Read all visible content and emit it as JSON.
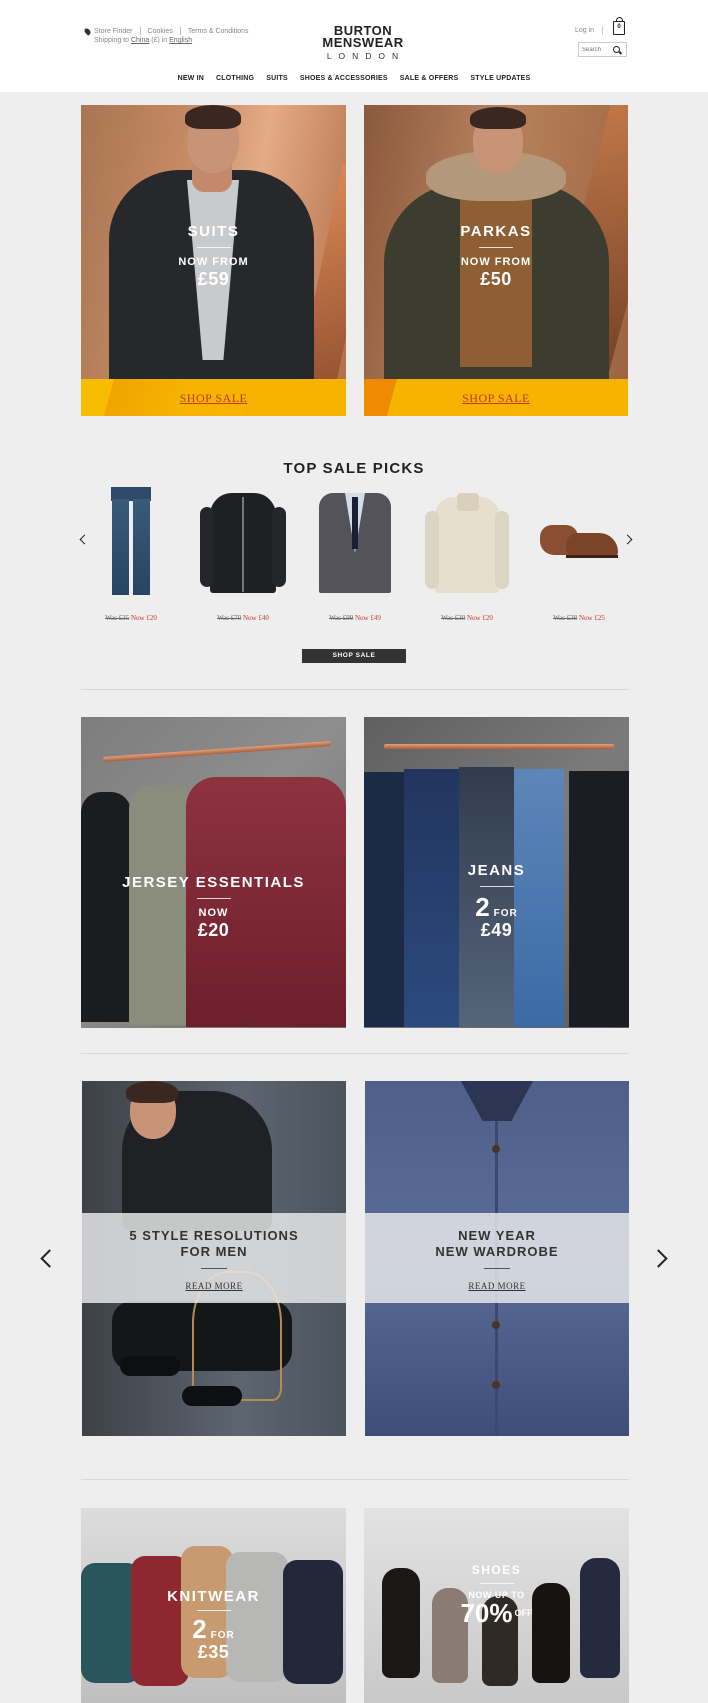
{
  "header": {
    "store_finder": "Store Finder",
    "cookies": "Cookies",
    "terms": "Terms & Conditions",
    "shipping_prefix": "Shipping to",
    "shipping_country": "China",
    "shipping_currency": "(£) in",
    "shipping_language": "English",
    "logo_line1": "BURTON",
    "logo_line2": "MENSWEAR",
    "logo_line3": "LONDON",
    "login": "Log in",
    "bag_count": "0",
    "search_placeholder": "Search"
  },
  "nav": [
    "NEW IN",
    "CLOTHING",
    "SUITS",
    "SHOES & ACCESSORIES",
    "SALE & OFFERS",
    "STYLE UPDATES"
  ],
  "hero": [
    {
      "title": "SUITS",
      "now_from": "NOW FROM",
      "price": "£59",
      "cta": "SHOP SALE"
    },
    {
      "title": "PARKAS",
      "now_from": "NOW FROM",
      "price": "£50",
      "cta": "SHOP SALE"
    }
  ],
  "top_sale_picks": {
    "title": "TOP SALE PICKS",
    "items": [
      {
        "name": "jeans",
        "was": "Was £35",
        "now": "Now £20"
      },
      {
        "name": "bomber-jacket",
        "was": "Was £70",
        "now": "Now £40"
      },
      {
        "name": "suit-jacket",
        "was": "Was £99",
        "now": "Now £49"
      },
      {
        "name": "knit-jumper",
        "was": "Was £30",
        "now": "Now £20"
      },
      {
        "name": "brogue-boots",
        "was": "Was £38",
        "now": "Now £25"
      }
    ],
    "button": "SHOP SALE"
  },
  "promo_row": [
    {
      "title": "JERSEY ESSENTIALS",
      "now": "NOW",
      "price": "£20"
    },
    {
      "title": "JEANS",
      "multi": "2",
      "for": "FOR",
      "price": "£49"
    }
  ],
  "articles": [
    {
      "title_line1": "5 STYLE RESOLUTIONS",
      "title_line2": "FOR MEN",
      "cta": "READ MORE"
    },
    {
      "title_line1": "NEW YEAR",
      "title_line2": "NEW WARDROBE",
      "cta": "READ MORE"
    }
  ],
  "bottom_row": [
    {
      "title": "KNITWEAR",
      "multi": "2",
      "for": "FOR",
      "price": "£35"
    },
    {
      "title": "SHOES",
      "now_up_to": "NOW UP TO",
      "percent": "70%",
      "off": "OFF"
    }
  ],
  "colors": {
    "sale_yellow": "#f6b400",
    "sale_red": "#c0392b",
    "background": "#eeeeee"
  }
}
